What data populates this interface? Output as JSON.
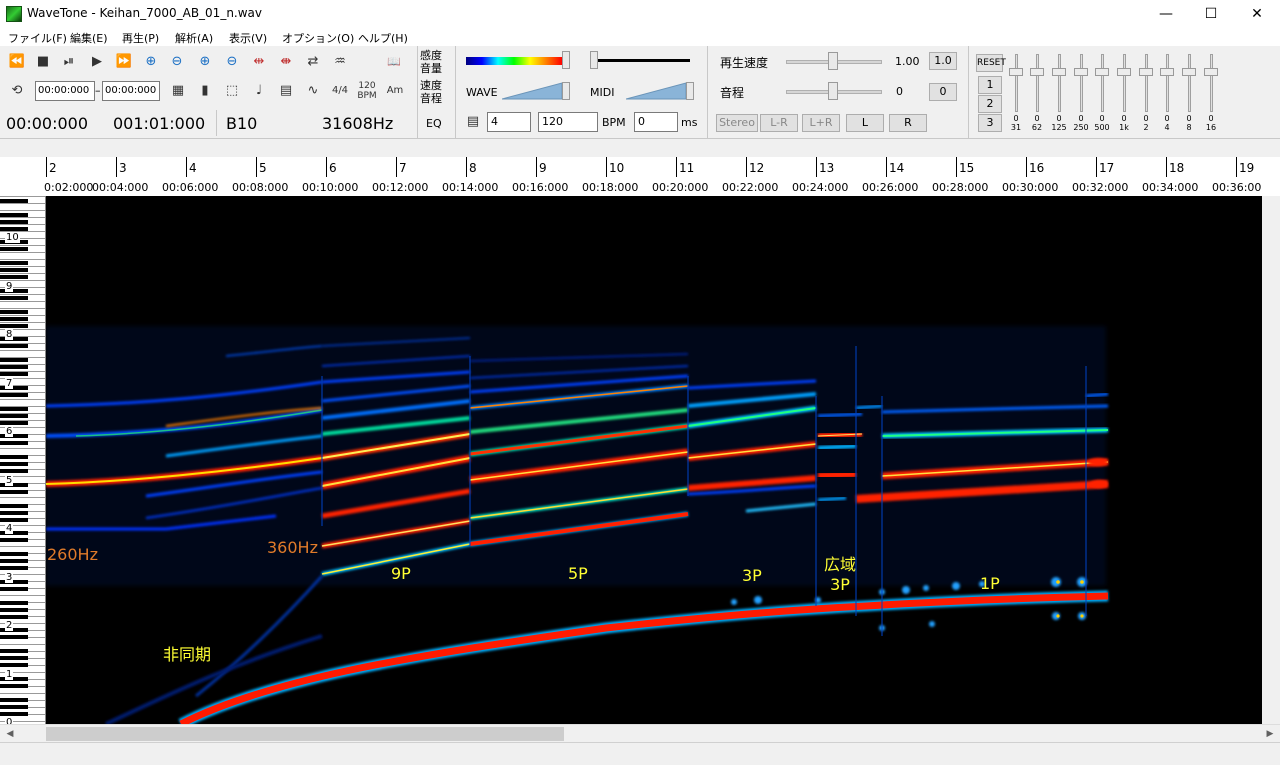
{
  "window": {
    "title": "WaveTone - Keihan_7000_AB_01_n.wav",
    "minimize": "—",
    "maximize": "☐",
    "close": "✕"
  },
  "menu": [
    "ファイル(F)",
    "編集(E)",
    "再生(P)",
    "解析(A)",
    "表示(V)",
    "オプション(O)",
    "ヘルプ(H)"
  ],
  "toolbar": {
    "icons_row1": [
      "rewind-icon",
      "stop-icon",
      "pause-icon",
      "play-icon",
      "fast-forward-icon",
      "zoom-in-horizontal-icon",
      "zoom-out-horizontal-icon",
      "zoom-in-vertical-icon",
      "zoom-out-vertical-icon",
      "expand-icon",
      "shrink-icon",
      "swap-icon",
      "waveform-icon",
      "book-icon"
    ],
    "glyphs_row1": [
      "⏪",
      "■",
      "⏯",
      "▶",
      "⏩",
      "⊕",
      "⊖",
      "⊕",
      "⊖",
      "⇹",
      "⇼",
      "⇄",
      "♒",
      "📖"
    ],
    "loop_glyph": "⟲",
    "time_from": "00:00:000",
    "time_dash": "–",
    "time_to": "00:00:000",
    "icons_row2": [
      "grid-icon",
      "marker-icon",
      "select-rect-icon",
      "note-icon",
      "table-icon",
      "curve-icon"
    ],
    "glyphs_row2": [
      "▦",
      "▮",
      "⬚",
      "♩",
      "▤",
      "∿"
    ],
    "time_sig": "4/4",
    "bpm_icon_top": "120",
    "bpm_icon_bottom": "BPM",
    "am_label": "Am",
    "position_time": "00:00:000",
    "position_measure": "001:01:000",
    "note": "B10",
    "frequency": "31608Hz",
    "sensitivity_top": "感度",
    "sensitivity_bottom": "音量",
    "speed_top": "速度",
    "speed_bottom": "音程",
    "eq_label": "EQ",
    "wave_label": "WAVE",
    "midi_label": "MIDI",
    "beats_value": "4",
    "bpm_value": "120",
    "bpm_unit": "BPM",
    "ms_value": "0",
    "ms_unit": "ms",
    "playback_speed_label": "再生速度",
    "playback_speed_value": "1.00",
    "playback_speed_reset": "1.0",
    "pitch_label": "音程",
    "pitch_value": "0",
    "pitch_reset": "0",
    "stereo_buttons": [
      "Stereo",
      "L-R",
      "L+R",
      "L",
      "R"
    ],
    "reset_label": "RESET",
    "preset_buttons": [
      "1",
      "2",
      "3"
    ]
  },
  "eq_bands": [
    {
      "gain": "0",
      "freq": "31"
    },
    {
      "gain": "0",
      "freq": "62"
    },
    {
      "gain": "0",
      "freq": "125"
    },
    {
      "gain": "0",
      "freq": "250"
    },
    {
      "gain": "0",
      "freq": "500"
    },
    {
      "gain": "0",
      "freq": "1k"
    },
    {
      "gain": "0",
      "freq": "2"
    },
    {
      "gain": "0",
      "freq": "4"
    },
    {
      "gain": "0",
      "freq": "8"
    },
    {
      "gain": "0",
      "freq": "16"
    }
  ],
  "ruler": {
    "measures": [
      "2",
      "3",
      "4",
      "5",
      "6",
      "7",
      "8",
      "9",
      "10",
      "11",
      "12",
      "13",
      "14",
      "15",
      "16",
      "17",
      "18",
      "19"
    ],
    "times": [
      "0:02:000",
      "00:04:000",
      "00:06:000",
      "00:08:000",
      "00:10:000",
      "00:12:000",
      "00:14:000",
      "00:16:000",
      "00:18:000",
      "00:20:000",
      "00:22:000",
      "00:24:000",
      "00:26:000",
      "00:28:000",
      "00:30:000",
      "00:32:000",
      "00:34:000",
      "00:36:00"
    ]
  },
  "keyboard": {
    "octaves": [
      "10",
      "9",
      "8",
      "7",
      "6",
      "5",
      "4",
      "3",
      "2",
      "1",
      "0"
    ]
  },
  "annotations": {
    "hz260": "260Hz",
    "hz360": "360Hz",
    "p9": "9P",
    "p5": "5P",
    "p3": "3P",
    "wide_top": "広域",
    "wide_bottom": "3P",
    "p1": "1P",
    "async": "非同期",
    "hz_color": "#e07b2a",
    "label_color": "#ffff33"
  },
  "scroll": {
    "left_arrow": "◀",
    "right_arrow": "▶"
  }
}
